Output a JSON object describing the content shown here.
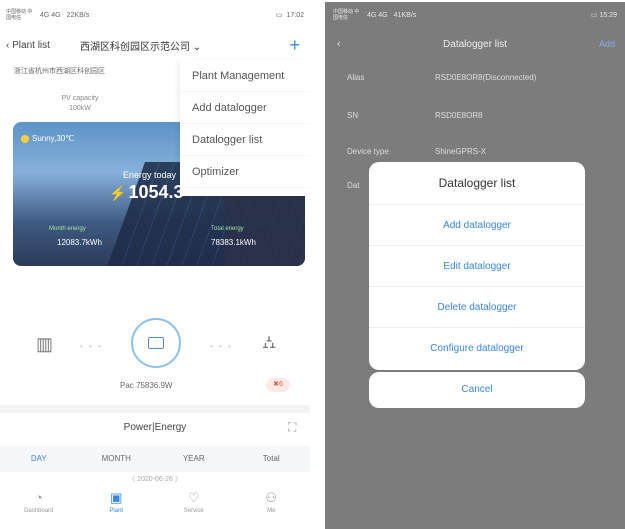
{
  "left": {
    "status": {
      "carrier": "中国移动 中国电信",
      "net": "4G 4G",
      "speed": "22KB/s",
      "time": "17:02"
    },
    "topbar": {
      "back_label": "Plant list",
      "plant_name": "西湖区科创园区示范公司",
      "add": "+"
    },
    "address": "浙江省杭州市西湖区科创园区",
    "pv_capacity_label": "PV capacity",
    "pv_capacity_value": "100kW",
    "menu": [
      "Plant Management",
      "Add datalogger",
      "Datalogger list",
      "Optimizer"
    ],
    "hero": {
      "weather": "Sunny,30℃",
      "energy_today_label": "Energy today",
      "energy_today_value": "1054.3",
      "month_label": "Month energy",
      "month_value": "12083.7kWh",
      "total_label": "Total energy",
      "total_value": "78383.1kWh"
    },
    "pac": "Pac 75836.9W",
    "alert_count": "6",
    "power_energy_title": "Power|Energy",
    "tabs": [
      "DAY",
      "MONTH",
      "YEAR",
      "Total"
    ],
    "active_tab": "DAY",
    "date_nav": "2020-06-26",
    "bottom_nav": [
      {
        "icon": "dashboard-icon",
        "label": "Dashboard"
      },
      {
        "icon": "plant-icon",
        "label": "Plant"
      },
      {
        "icon": "service-icon",
        "label": "Service"
      },
      {
        "icon": "me-icon",
        "label": "Me"
      }
    ],
    "active_nav": "Plant"
  },
  "right": {
    "status": {
      "carrier": "中国移动 中国电信",
      "net": "4G 4G",
      "speed": "41KB/s",
      "time": "15:29"
    },
    "header": {
      "title": "Datalogger list",
      "add": "Add"
    },
    "rows": [
      {
        "key": "Alias",
        "value": "RSD0E8OR8(Disconnected)"
      },
      {
        "key": "SN",
        "value": "RSD0E8OR8"
      },
      {
        "key": "Device type",
        "value": "ShineGPRS-X"
      },
      {
        "key": "Dat",
        "value": ""
      }
    ],
    "modal": {
      "title": "Datalogger list",
      "options": [
        "Add datalogger",
        "Edit datalogger",
        "Delete datalogger",
        "Configure datalogger"
      ],
      "cancel": "Cancel"
    }
  }
}
